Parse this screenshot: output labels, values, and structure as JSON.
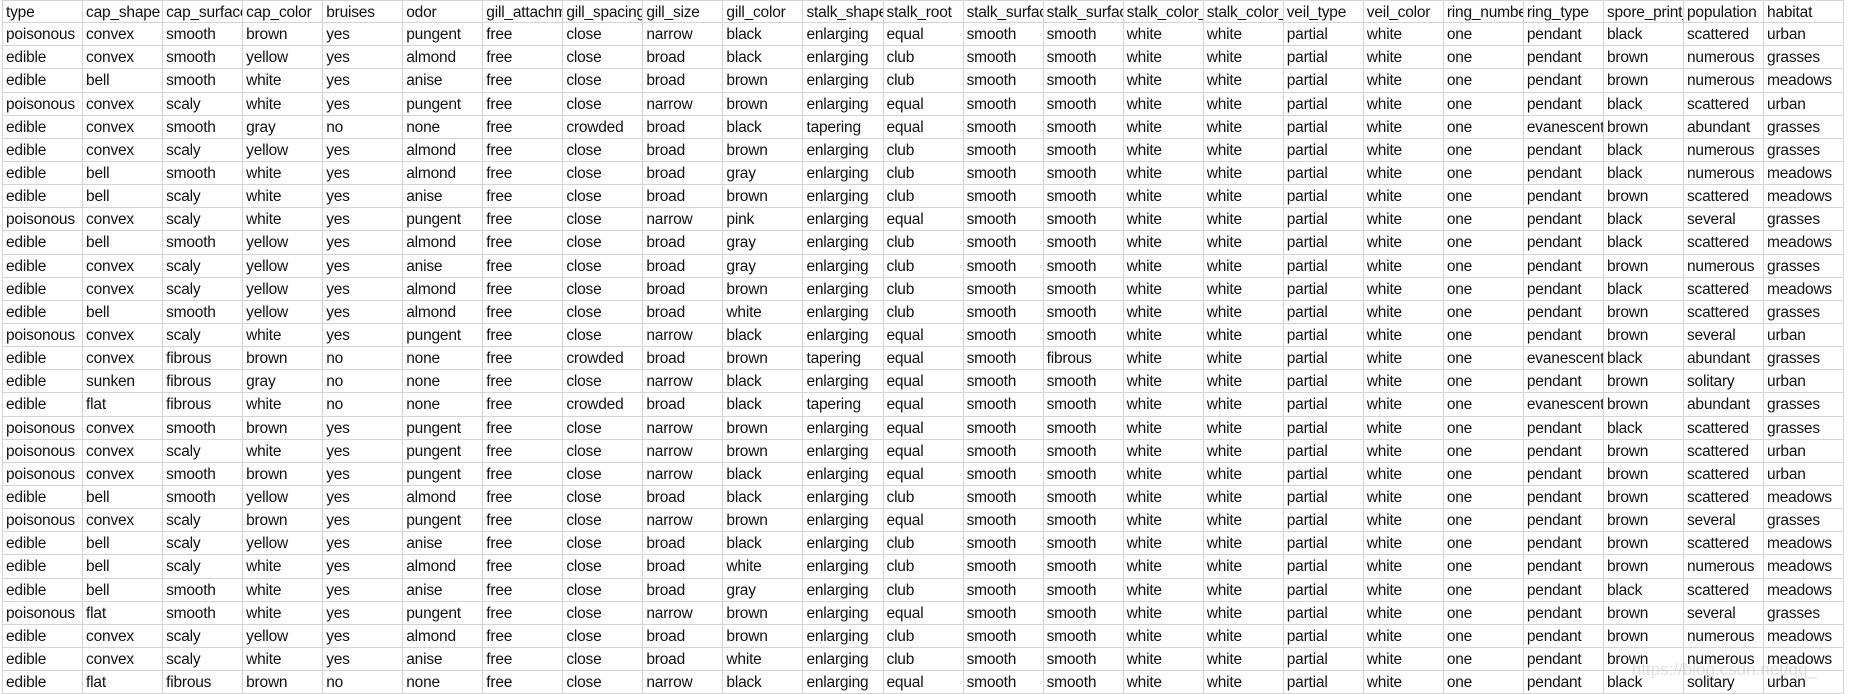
{
  "columns": [
    "type",
    "cap_shape",
    "cap_surface",
    "cap_color",
    "bruises",
    "odor",
    "gill_attachment",
    "gill_spacing",
    "gill_size",
    "gill_color",
    "stalk_shape",
    "stalk_root",
    "stalk_surface_above_ring",
    "stalk_surface_below_ring",
    "stalk_color_above_ring",
    "stalk_color_below_ring",
    "veil_type",
    "veil_color",
    "ring_number",
    "ring_type",
    "spore_print_color",
    "population",
    "habitat"
  ],
  "rows": [
    [
      "poisonous",
      "convex",
      "smooth",
      "brown",
      "yes",
      "pungent",
      "free",
      "close",
      "narrow",
      "black",
      "enlarging",
      "equal",
      "smooth",
      "smooth",
      "white",
      "white",
      "partial",
      "white",
      "one",
      "pendant",
      "black",
      "scattered",
      "urban"
    ],
    [
      "edible",
      "convex",
      "smooth",
      "yellow",
      "yes",
      "almond",
      "free",
      "close",
      "broad",
      "black",
      "enlarging",
      "club",
      "smooth",
      "smooth",
      "white",
      "white",
      "partial",
      "white",
      "one",
      "pendant",
      "brown",
      "numerous",
      "grasses"
    ],
    [
      "edible",
      "bell",
      "smooth",
      "white",
      "yes",
      "anise",
      "free",
      "close",
      "broad",
      "brown",
      "enlarging",
      "club",
      "smooth",
      "smooth",
      "white",
      "white",
      "partial",
      "white",
      "one",
      "pendant",
      "brown",
      "numerous",
      "meadows"
    ],
    [
      "poisonous",
      "convex",
      "scaly",
      "white",
      "yes",
      "pungent",
      "free",
      "close",
      "narrow",
      "brown",
      "enlarging",
      "equal",
      "smooth",
      "smooth",
      "white",
      "white",
      "partial",
      "white",
      "one",
      "pendant",
      "black",
      "scattered",
      "urban"
    ],
    [
      "edible",
      "convex",
      "smooth",
      "gray",
      "no",
      "none",
      "free",
      "crowded",
      "broad",
      "black",
      "tapering",
      "equal",
      "smooth",
      "smooth",
      "white",
      "white",
      "partial",
      "white",
      "one",
      "evanescent",
      "brown",
      "abundant",
      "grasses"
    ],
    [
      "edible",
      "convex",
      "scaly",
      "yellow",
      "yes",
      "almond",
      "free",
      "close",
      "broad",
      "brown",
      "enlarging",
      "club",
      "smooth",
      "smooth",
      "white",
      "white",
      "partial",
      "white",
      "one",
      "pendant",
      "black",
      "numerous",
      "grasses"
    ],
    [
      "edible",
      "bell",
      "smooth",
      "white",
      "yes",
      "almond",
      "free",
      "close",
      "broad",
      "gray",
      "enlarging",
      "club",
      "smooth",
      "smooth",
      "white",
      "white",
      "partial",
      "white",
      "one",
      "pendant",
      "black",
      "numerous",
      "meadows"
    ],
    [
      "edible",
      "bell",
      "scaly",
      "white",
      "yes",
      "anise",
      "free",
      "close",
      "broad",
      "brown",
      "enlarging",
      "club",
      "smooth",
      "smooth",
      "white",
      "white",
      "partial",
      "white",
      "one",
      "pendant",
      "brown",
      "scattered",
      "meadows"
    ],
    [
      "poisonous",
      "convex",
      "scaly",
      "white",
      "yes",
      "pungent",
      "free",
      "close",
      "narrow",
      "pink",
      "enlarging",
      "equal",
      "smooth",
      "smooth",
      "white",
      "white",
      "partial",
      "white",
      "one",
      "pendant",
      "black",
      "several",
      "grasses"
    ],
    [
      "edible",
      "bell",
      "smooth",
      "yellow",
      "yes",
      "almond",
      "free",
      "close",
      "broad",
      "gray",
      "enlarging",
      "club",
      "smooth",
      "smooth",
      "white",
      "white",
      "partial",
      "white",
      "one",
      "pendant",
      "black",
      "scattered",
      "meadows"
    ],
    [
      "edible",
      "convex",
      "scaly",
      "yellow",
      "yes",
      "anise",
      "free",
      "close",
      "broad",
      "gray",
      "enlarging",
      "club",
      "smooth",
      "smooth",
      "white",
      "white",
      "partial",
      "white",
      "one",
      "pendant",
      "brown",
      "numerous",
      "grasses"
    ],
    [
      "edible",
      "convex",
      "scaly",
      "yellow",
      "yes",
      "almond",
      "free",
      "close",
      "broad",
      "brown",
      "enlarging",
      "club",
      "smooth",
      "smooth",
      "white",
      "white",
      "partial",
      "white",
      "one",
      "pendant",
      "black",
      "scattered",
      "meadows"
    ],
    [
      "edible",
      "bell",
      "smooth",
      "yellow",
      "yes",
      "almond",
      "free",
      "close",
      "broad",
      "white",
      "enlarging",
      "club",
      "smooth",
      "smooth",
      "white",
      "white",
      "partial",
      "white",
      "one",
      "pendant",
      "brown",
      "scattered",
      "grasses"
    ],
    [
      "poisonous",
      "convex",
      "scaly",
      "white",
      "yes",
      "pungent",
      "free",
      "close",
      "narrow",
      "black",
      "enlarging",
      "equal",
      "smooth",
      "smooth",
      "white",
      "white",
      "partial",
      "white",
      "one",
      "pendant",
      "brown",
      "several",
      "urban"
    ],
    [
      "edible",
      "convex",
      "fibrous",
      "brown",
      "no",
      "none",
      "free",
      "crowded",
      "broad",
      "brown",
      "tapering",
      "equal",
      "smooth",
      "fibrous",
      "white",
      "white",
      "partial",
      "white",
      "one",
      "evanescent",
      "black",
      "abundant",
      "grasses"
    ],
    [
      "edible",
      "sunken",
      "fibrous",
      "gray",
      "no",
      "none",
      "free",
      "close",
      "narrow",
      "black",
      "enlarging",
      "equal",
      "smooth",
      "smooth",
      "white",
      "white",
      "partial",
      "white",
      "one",
      "pendant",
      "brown",
      "solitary",
      "urban"
    ],
    [
      "edible",
      "flat",
      "fibrous",
      "white",
      "no",
      "none",
      "free",
      "crowded",
      "broad",
      "black",
      "tapering",
      "equal",
      "smooth",
      "smooth",
      "white",
      "white",
      "partial",
      "white",
      "one",
      "evanescent",
      "brown",
      "abundant",
      "grasses"
    ],
    [
      "poisonous",
      "convex",
      "smooth",
      "brown",
      "yes",
      "pungent",
      "free",
      "close",
      "narrow",
      "brown",
      "enlarging",
      "equal",
      "smooth",
      "smooth",
      "white",
      "white",
      "partial",
      "white",
      "one",
      "pendant",
      "black",
      "scattered",
      "grasses"
    ],
    [
      "poisonous",
      "convex",
      "scaly",
      "white",
      "yes",
      "pungent",
      "free",
      "close",
      "narrow",
      "brown",
      "enlarging",
      "equal",
      "smooth",
      "smooth",
      "white",
      "white",
      "partial",
      "white",
      "one",
      "pendant",
      "brown",
      "scattered",
      "urban"
    ],
    [
      "poisonous",
      "convex",
      "smooth",
      "brown",
      "yes",
      "pungent",
      "free",
      "close",
      "narrow",
      "black",
      "enlarging",
      "equal",
      "smooth",
      "smooth",
      "white",
      "white",
      "partial",
      "white",
      "one",
      "pendant",
      "brown",
      "scattered",
      "urban"
    ],
    [
      "edible",
      "bell",
      "smooth",
      "yellow",
      "yes",
      "almond",
      "free",
      "close",
      "broad",
      "black",
      "enlarging",
      "club",
      "smooth",
      "smooth",
      "white",
      "white",
      "partial",
      "white",
      "one",
      "pendant",
      "brown",
      "scattered",
      "meadows"
    ],
    [
      "poisonous",
      "convex",
      "scaly",
      "brown",
      "yes",
      "pungent",
      "free",
      "close",
      "narrow",
      "brown",
      "enlarging",
      "equal",
      "smooth",
      "smooth",
      "white",
      "white",
      "partial",
      "white",
      "one",
      "pendant",
      "brown",
      "several",
      "grasses"
    ],
    [
      "edible",
      "bell",
      "scaly",
      "yellow",
      "yes",
      "anise",
      "free",
      "close",
      "broad",
      "black",
      "enlarging",
      "club",
      "smooth",
      "smooth",
      "white",
      "white",
      "partial",
      "white",
      "one",
      "pendant",
      "brown",
      "scattered",
      "meadows"
    ],
    [
      "edible",
      "bell",
      "scaly",
      "white",
      "yes",
      "almond",
      "free",
      "close",
      "broad",
      "white",
      "enlarging",
      "club",
      "smooth",
      "smooth",
      "white",
      "white",
      "partial",
      "white",
      "one",
      "pendant",
      "brown",
      "numerous",
      "meadows"
    ],
    [
      "edible",
      "bell",
      "smooth",
      "white",
      "yes",
      "anise",
      "free",
      "close",
      "broad",
      "gray",
      "enlarging",
      "club",
      "smooth",
      "smooth",
      "white",
      "white",
      "partial",
      "white",
      "one",
      "pendant",
      "black",
      "scattered",
      "meadows"
    ],
    [
      "poisonous",
      "flat",
      "smooth",
      "white",
      "yes",
      "pungent",
      "free",
      "close",
      "narrow",
      "brown",
      "enlarging",
      "equal",
      "smooth",
      "smooth",
      "white",
      "white",
      "partial",
      "white",
      "one",
      "pendant",
      "brown",
      "several",
      "grasses"
    ],
    [
      "edible",
      "convex",
      "scaly",
      "yellow",
      "yes",
      "almond",
      "free",
      "close",
      "broad",
      "brown",
      "enlarging",
      "club",
      "smooth",
      "smooth",
      "white",
      "white",
      "partial",
      "white",
      "one",
      "pendant",
      "brown",
      "numerous",
      "meadows"
    ],
    [
      "edible",
      "convex",
      "scaly",
      "white",
      "yes",
      "anise",
      "free",
      "close",
      "broad",
      "white",
      "enlarging",
      "club",
      "smooth",
      "smooth",
      "white",
      "white",
      "partial",
      "white",
      "one",
      "pendant",
      "brown",
      "numerous",
      "meadows"
    ],
    [
      "edible",
      "flat",
      "fibrous",
      "brown",
      "no",
      "none",
      "free",
      "close",
      "narrow",
      "black",
      "enlarging",
      "equal",
      "smooth",
      "smooth",
      "white",
      "white",
      "partial",
      "white",
      "one",
      "pendant",
      "black",
      "solitary",
      "urban"
    ]
  ],
  "watermark": "https://blog.csdn.net/qq_",
  "colors": {
    "gridline": "#d4d4d4",
    "text": "#111111",
    "background": "#ffffff"
  }
}
